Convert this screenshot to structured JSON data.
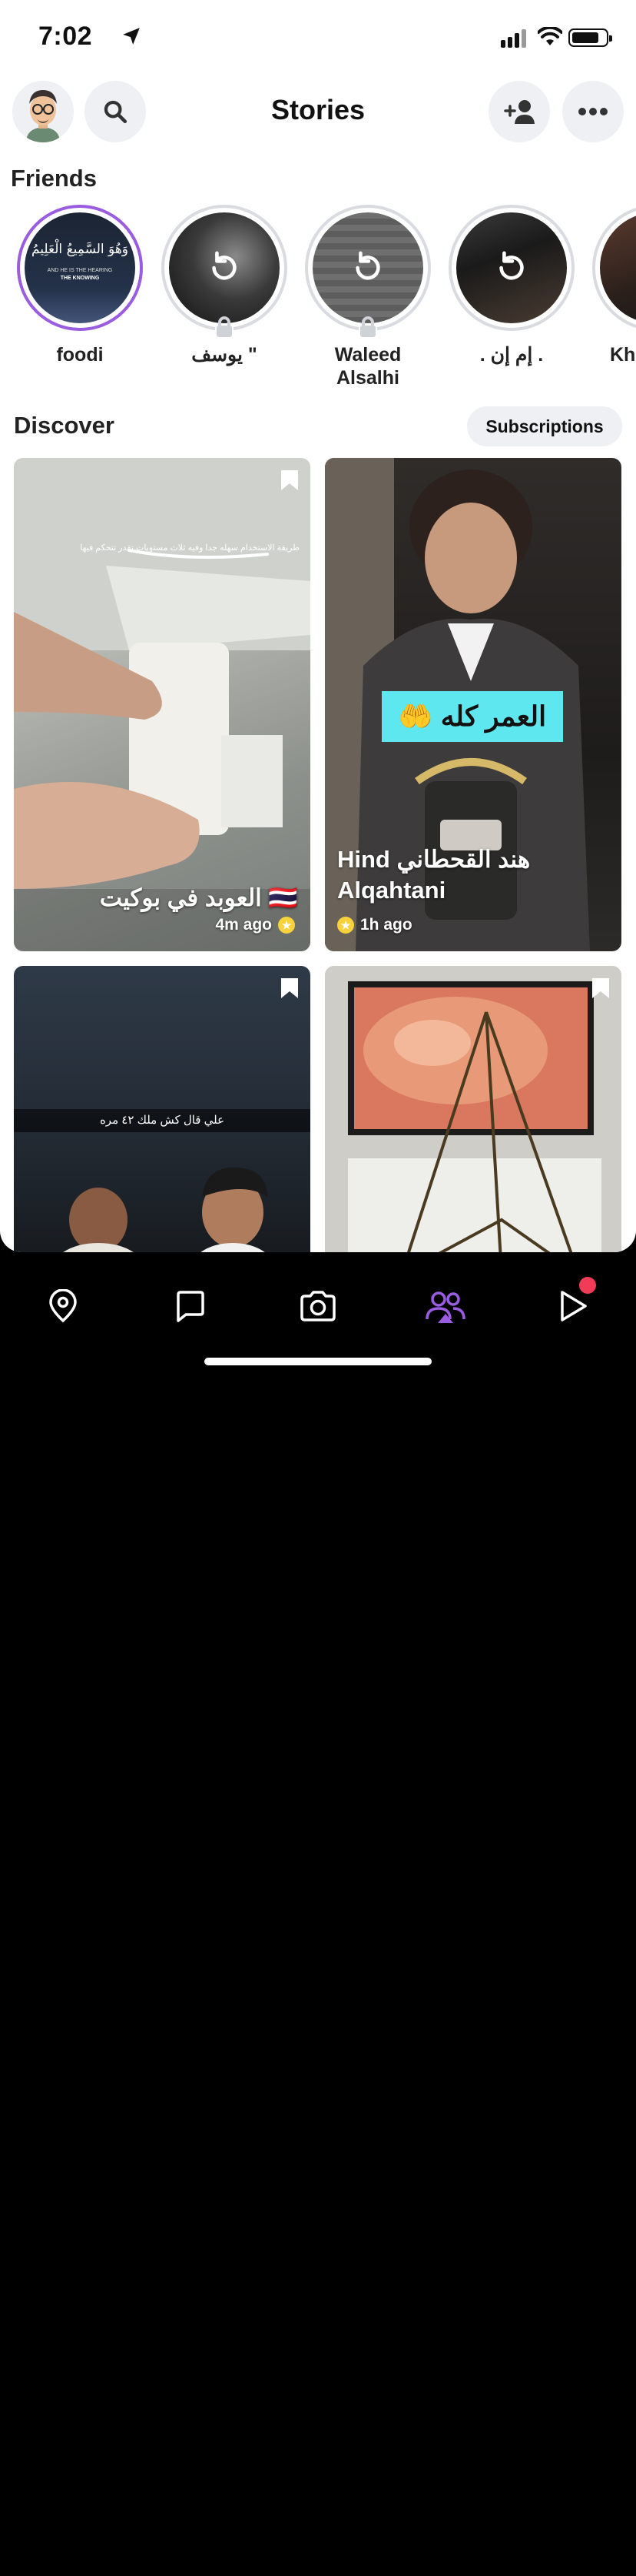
{
  "status_bar": {
    "time": "7:02"
  },
  "header": {
    "title": "Stories"
  },
  "friends": {
    "title": "Friends",
    "items": [
      {
        "name": "foodi",
        "new": true,
        "caption_top": "وَهُوَ السَّمِيعُ الْعَلِيمُ",
        "caption_en1": "AND HE IS THE HEARING",
        "caption_en2": "THE KNOWING"
      },
      {
        "name": "يوسف \"",
        "new": false
      },
      {
        "name": "Waleed Alsalhi",
        "new": false
      },
      {
        "name": ". إم إن .",
        "new": false
      },
      {
        "name": "Kh",
        "new": false
      }
    ]
  },
  "discover": {
    "title": "Discover",
    "subscriptions_label": "Subscriptions",
    "tiles": [
      {
        "title": "العوبد في بوكيت 🇹🇭",
        "meta": "4m ago",
        "overlay_text": "طريقة الاستخدام سهله جدا وفيه ثلاث مستويات تقدر تتحكم فيها"
      },
      {
        "title": "Hind هند القحطاني Alqahtani",
        "meta": "1h ago",
        "overlay_text": "العمر كله 🤲"
      },
      {
        "title": "",
        "meta": "",
        "overlay_text": "علي قال كش ملك ٤٢ مره"
      },
      {
        "title": "",
        "meta": "",
        "overlay_text": ""
      }
    ]
  },
  "colors": {
    "accent": "#9a5ce0",
    "badge": "#f7d23a",
    "nav_active": "#9a5ce0",
    "notification": "#f23c57"
  }
}
